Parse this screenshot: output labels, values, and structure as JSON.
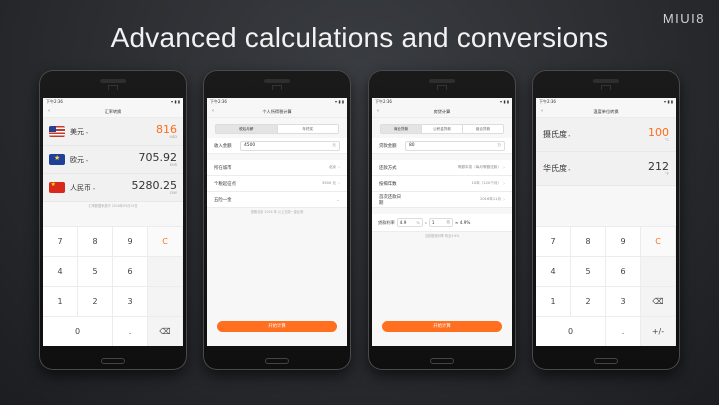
{
  "headline": "Advanced calculations and conversions",
  "logo": "MIUI8",
  "status": {
    "time": "下午2:36",
    "signal": "▾ ▮ ▮"
  },
  "accent": "#ff6b1a",
  "phone1": {
    "title": "汇率转换",
    "currencies": [
      {
        "name": "美元",
        "value": "816",
        "code": "USD",
        "flag": "flag-us"
      },
      {
        "name": "欧元",
        "value": "705.92",
        "code": "EUR",
        "flag": "flag-eu"
      },
      {
        "name": "人民币",
        "value": "5280.25",
        "code": "CNY",
        "flag": "flag-cn"
      }
    ],
    "note": "汇率数据来源于 2016年05月15日",
    "keys": [
      "7",
      "8",
      "9",
      "C",
      "4",
      "5",
      "6",
      "",
      "1",
      "2",
      "3",
      "",
      "0",
      ".",
      "⌫"
    ]
  },
  "phone2": {
    "title": "个人所得税计算",
    "tabs": [
      "税后月薪",
      "年终奖"
    ],
    "income_label": "收入金额",
    "income_value": "4500",
    "unit": "元",
    "rows": [
      {
        "label": "所在城市",
        "value": "北京"
      },
      {
        "label": "个税起征点",
        "value": "3500 元"
      },
      {
        "label": "五险一金",
        "value": ""
      }
    ],
    "hint": "按照北京 2016 年 以上五险一金比例",
    "button": "开始计算"
  },
  "phone3": {
    "title": "房贷计算",
    "tabs": [
      "商业贷款",
      "公积金贷款",
      "组合贷款"
    ],
    "loan_label": "贷款金额",
    "loan_value": "80",
    "unit": "万",
    "rows": [
      {
        "label": "还款方式",
        "value": "等额本息（每月等额还款）"
      },
      {
        "label": "按揭年数",
        "value": "10年（120个月）"
      },
      {
        "label": "首次还款日期",
        "value": "2016年11月"
      }
    ],
    "rate_label": "贷款利率",
    "rate_value": "4.9",
    "rate_unit": "%",
    "multiplier": "1",
    "multiplier_unit": "倍",
    "rate_result": "≈ 4.9%",
    "hint": "当前基准利率 商业4.9%",
    "button": "开始计算"
  },
  "phone4": {
    "title": "温度单位转换",
    "rows": [
      {
        "name": "摄氏度",
        "value": "100",
        "unit": "°C"
      },
      {
        "name": "华氏度",
        "value": "212",
        "unit": "°F"
      }
    ],
    "keys": [
      "7",
      "8",
      "9",
      "C",
      "4",
      "5",
      "6",
      "",
      "1",
      "2",
      "3",
      "⌫",
      "0",
      ".",
      "+/-"
    ]
  }
}
